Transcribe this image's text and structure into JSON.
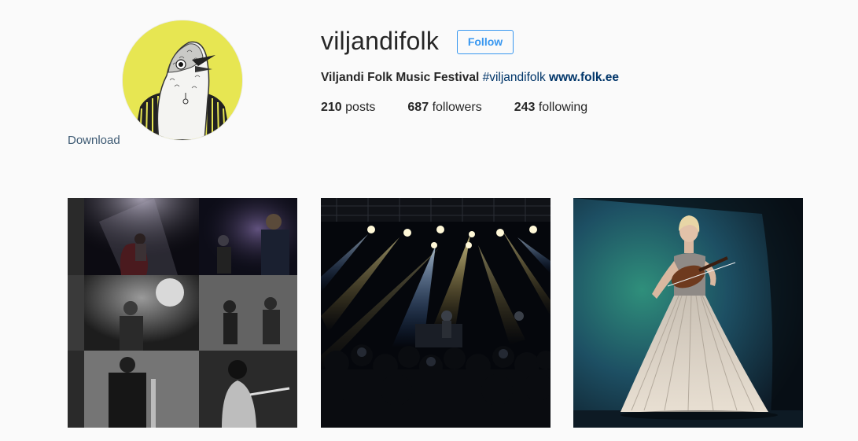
{
  "profile": {
    "username": "viljandifolk",
    "follow_label": "Follow",
    "download_label": "Download",
    "avatar_icon": "bird-illustration-avatar",
    "full_name": "Viljandi Folk Music Festival",
    "hashtag": "#viljandifolk",
    "website": "www.folk.ee"
  },
  "stats": {
    "posts_count": "210",
    "posts_label": "posts",
    "followers_count": "687",
    "followers_label": "followers",
    "following_count": "243",
    "following_label": "following"
  },
  "colors": {
    "background": "#fafafa",
    "follow_blue": "#3897f0",
    "link_dark_blue": "#003569",
    "avatar_yellow": "#e7e652"
  }
}
